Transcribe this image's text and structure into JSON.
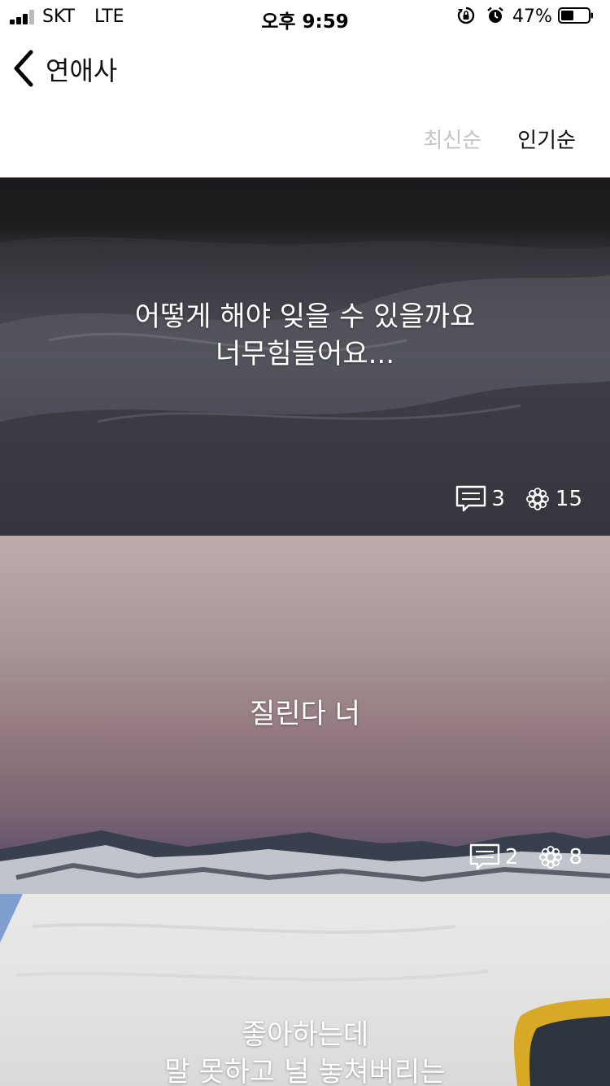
{
  "status_bar": {
    "carrier": "SKT",
    "network": "LTE",
    "time": "오후 9:59",
    "battery_percent": "47%",
    "battery_level": 0.47,
    "icons": [
      "signal-icon",
      "rotation-lock-icon",
      "alarm-icon",
      "battery-icon"
    ]
  },
  "nav": {
    "back_icon": "chevron-left-icon",
    "title": "연애사"
  },
  "sort_tabs": {
    "latest": "최신순",
    "popular": "인기순",
    "selected": "popular"
  },
  "posts": [
    {
      "lines": [
        "어떻게 해야 잊을 수 있을까요",
        "너무힘들어요..."
      ],
      "comment_count": "3",
      "like_count": "15"
    },
    {
      "lines": [
        "질린다 너"
      ],
      "comment_count": "2",
      "like_count": "8"
    },
    {
      "lines": [
        "좋아하는데",
        "말 못하고 널 놓쳐버리는"
      ]
    }
  ],
  "colors": {
    "selected_tab": "#111111",
    "unselected_tab": "#c4c4c4",
    "card_text": "#ffffff"
  }
}
